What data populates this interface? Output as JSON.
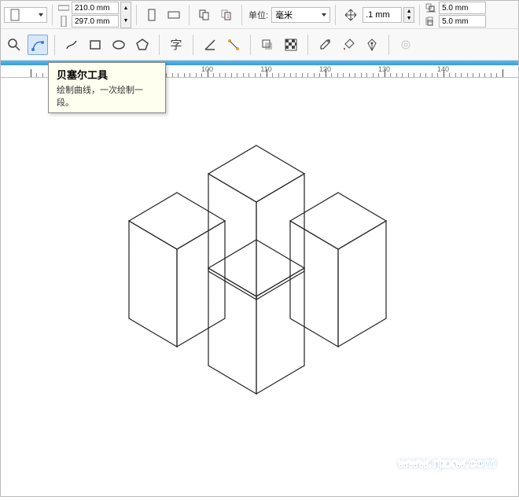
{
  "top_toolbar": {
    "page_width": "210.0 mm",
    "page_height": "297.0 mm",
    "units_label": "单位:",
    "units_value": "毫米",
    "nudge_value": ".1 mm",
    "dup_x": "5.0 mm",
    "dup_y": "5.0 mm"
  },
  "tooltip": {
    "title": "贝塞尔工具",
    "desc": "绘制曲线，一次绘制一段。"
  },
  "ruler": {
    "ticks": [
      100,
      110,
      120,
      130,
      140
    ]
  },
  "watermark": "www.rjzxw.com"
}
